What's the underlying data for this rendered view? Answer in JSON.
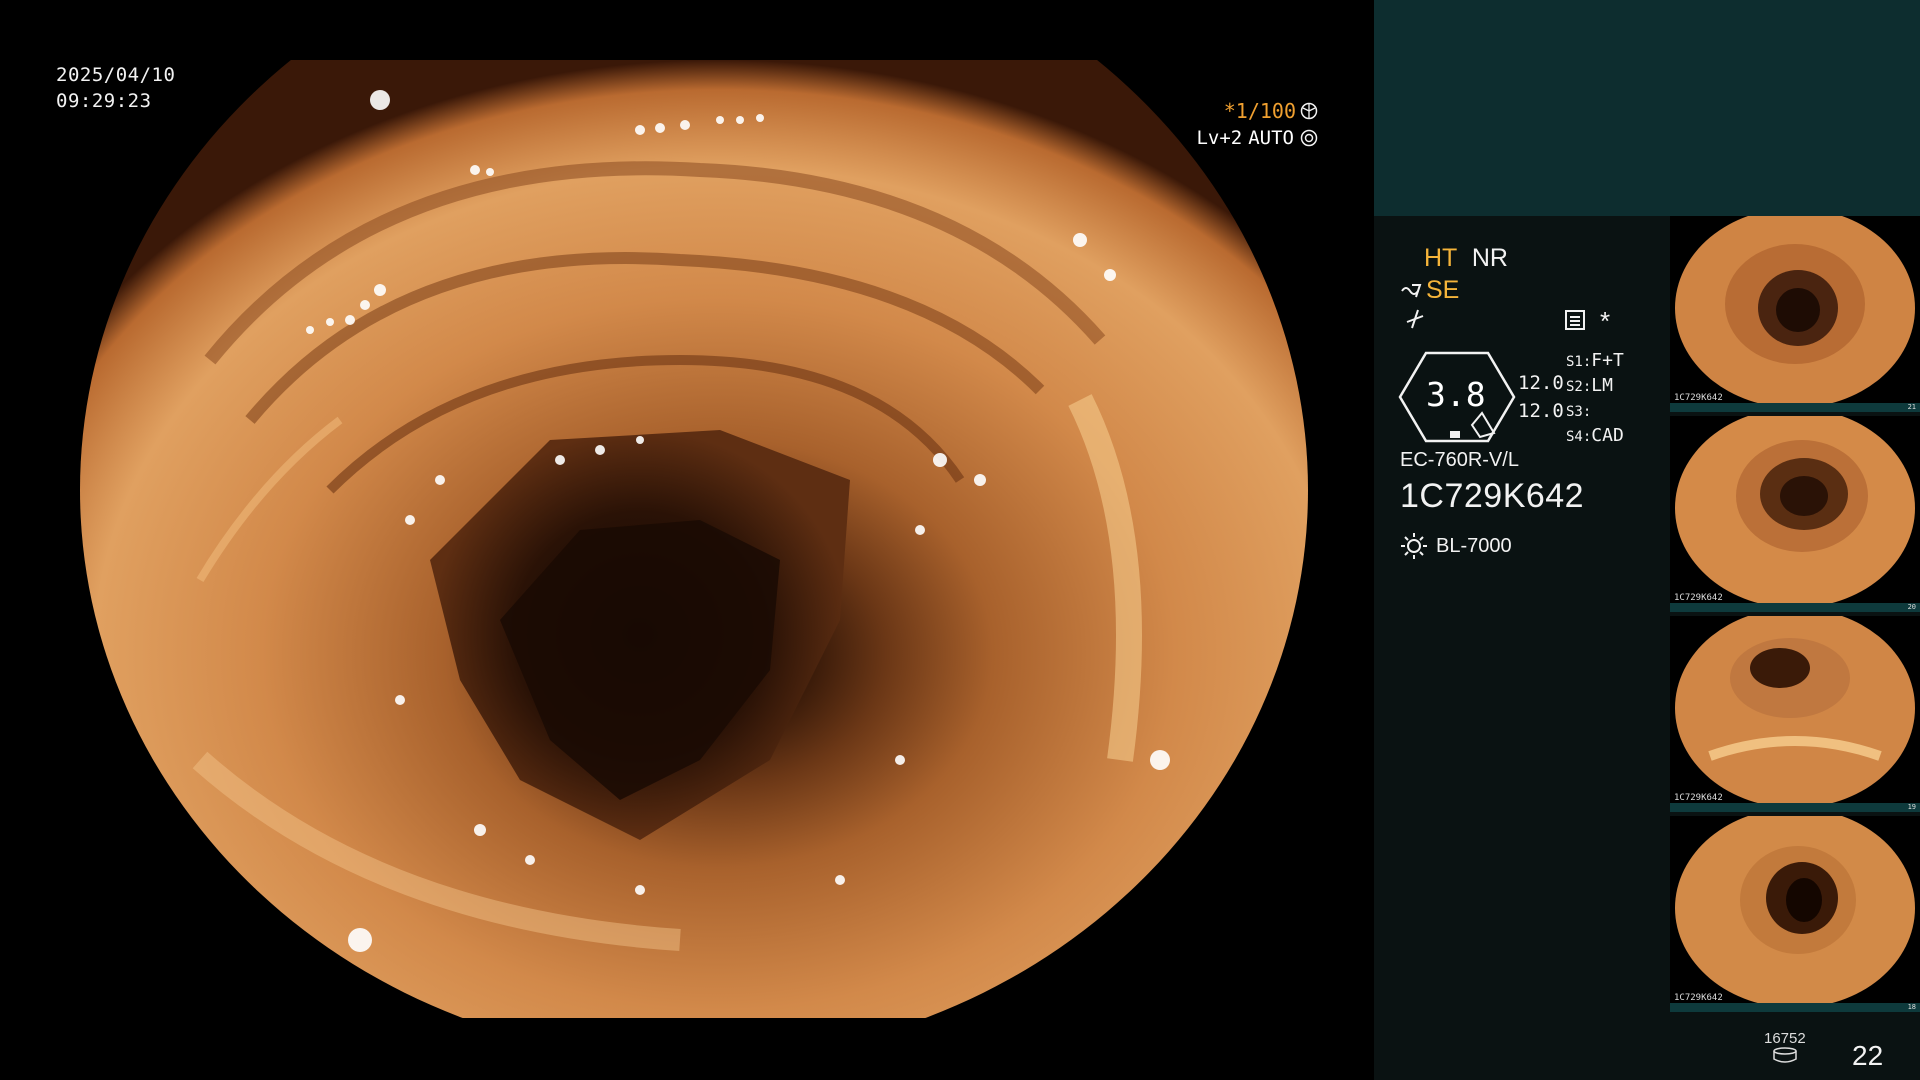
{
  "osd": {
    "date": "2025/04/10",
    "time": "09:29:23",
    "shutter": "*1/100",
    "level": "Lv+2",
    "auto": "AUTO"
  },
  "panel": {
    "ht": "HT",
    "nr": "NR",
    "se": "SE",
    "zoom": "3.8",
    "val1": "12.0",
    "val2": "12.0",
    "s1_key": "S1:",
    "s1_val": "F+T",
    "s2_key": "S2:",
    "s2_val": "LM",
    "s3_key": "S3:",
    "s3_val": "",
    "s4_key": "S4:",
    "s4_val": "CAD",
    "star": "*",
    "scope_model": "EC-760R-V/L",
    "scope_serial": "1C729K642",
    "light_source": "BL-7000",
    "storage_count": "16752",
    "image_count": "22"
  },
  "thumbnails": [
    {
      "label": "1C729K642",
      "index": "21"
    },
    {
      "label": "1C729K642",
      "index": "20"
    },
    {
      "label": "1C729K642",
      "index": "19"
    },
    {
      "label": "1C729K642",
      "index": "18"
    }
  ],
  "colors": {
    "accent_orange": "#f5b43a",
    "panel_teal": "#0d2d2f",
    "panel_bg": "#0a1212"
  }
}
